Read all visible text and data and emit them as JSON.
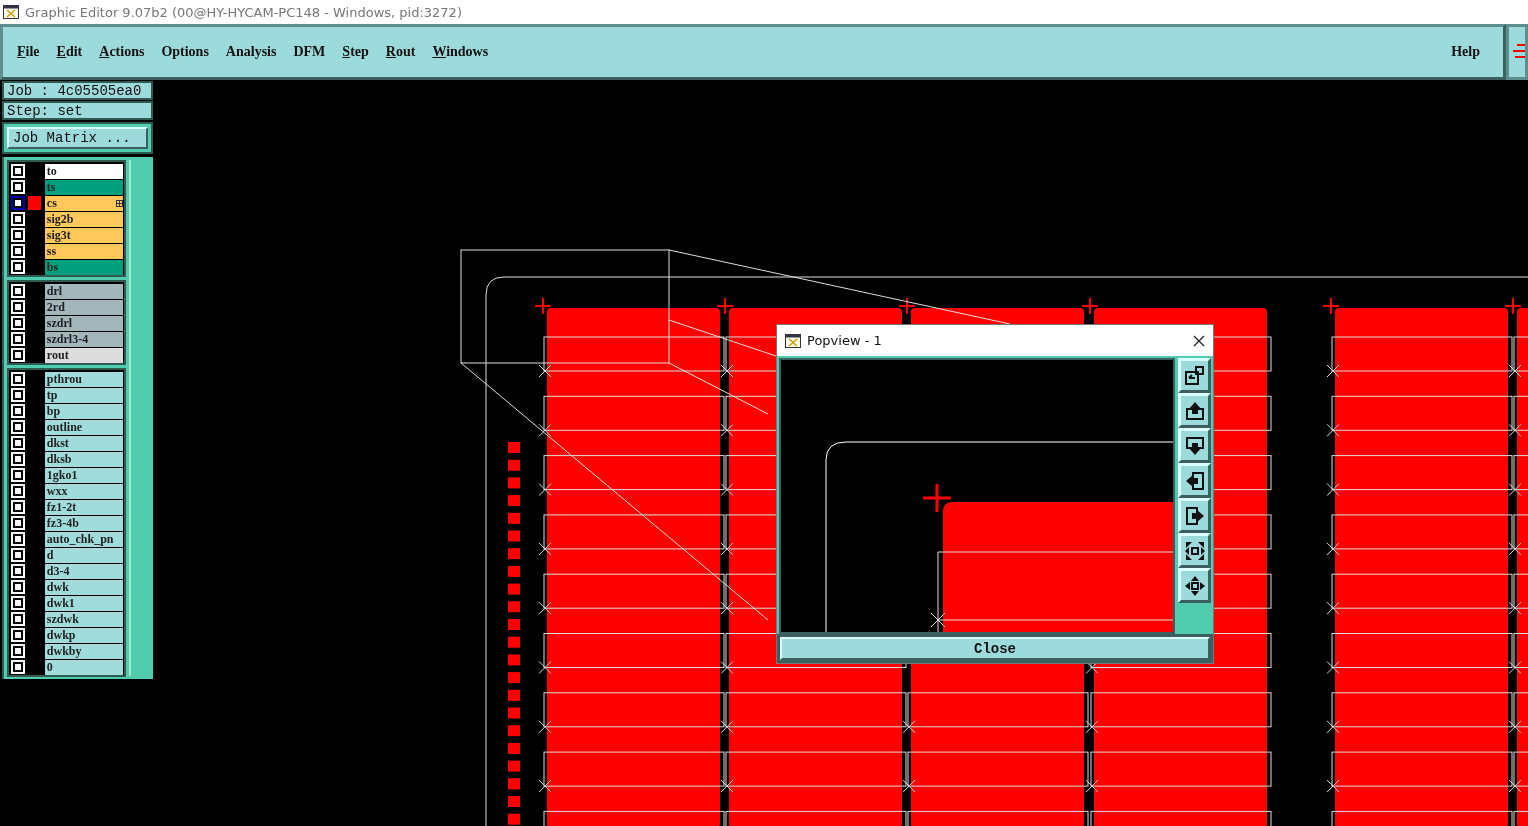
{
  "window": {
    "title": "Graphic Editor 9.07b2 (00@HY-HYCAM-PC148 - Windows, pid:3272)"
  },
  "menu": [
    {
      "label": "File",
      "mnemonic": true
    },
    {
      "label": "Edit",
      "mnemonic": true
    },
    {
      "label": "Actions",
      "mnemonic": true
    },
    {
      "label": "Options",
      "mnemonic": false
    },
    {
      "label": "Analysis",
      "mnemonic": false
    },
    {
      "label": "DFM",
      "mnemonic": false
    },
    {
      "label": "Step",
      "mnemonic": true
    },
    {
      "label": "Rout",
      "mnemonic": true
    },
    {
      "label": "Windows",
      "mnemonic": true
    }
  ],
  "help": {
    "label": "Help"
  },
  "job": "Job : 4c05505ea0",
  "step": "Step: set",
  "job_matrix_button": "Job Matrix ...",
  "layer_groups": [
    {
      "layers": [
        {
          "name": "to",
          "color": "#ffffff",
          "selected": false
        },
        {
          "name": "ts",
          "color": "#00a07c",
          "selected": false
        },
        {
          "name": "cs",
          "color": "#ffc85a",
          "selected": true
        },
        {
          "name": "sig2b",
          "color": "#ffc85a",
          "selected": false
        },
        {
          "name": "sig3t",
          "color": "#ffc85a",
          "selected": false
        },
        {
          "name": "ss",
          "color": "#ffc85a",
          "selected": false
        },
        {
          "name": "bs",
          "color": "#00a07c",
          "selected": false
        }
      ]
    },
    {
      "layers": [
        {
          "name": "drl",
          "color": "#a2b6bc",
          "selected": false
        },
        {
          "name": "2rd",
          "color": "#a2b6bc",
          "selected": false
        },
        {
          "name": "szdrl",
          "color": "#a2b6bc",
          "selected": false
        },
        {
          "name": "szdrl3-4",
          "color": "#a2b6bc",
          "selected": false
        },
        {
          "name": "rout",
          "color": "#dcdcdc",
          "selected": false
        }
      ]
    },
    {
      "layers": [
        {
          "name": "pthrou",
          "color": "#a0dcdc",
          "selected": false
        },
        {
          "name": "tp",
          "color": "#a0dcdc",
          "selected": false
        },
        {
          "name": "bp",
          "color": "#a0dcdc",
          "selected": false
        },
        {
          "name": "outline",
          "color": "#a0dcdc",
          "selected": false
        },
        {
          "name": "dkst",
          "color": "#a0dcdc",
          "selected": false
        },
        {
          "name": "dksb",
          "color": "#a0dcdc",
          "selected": false
        },
        {
          "name": "1gko1",
          "color": "#a0dcdc",
          "selected": false
        },
        {
          "name": "wxx",
          "color": "#a0dcdc",
          "selected": false
        },
        {
          "name": "fz1-2t",
          "color": "#a0dcdc",
          "selected": false
        },
        {
          "name": "fz3-4b",
          "color": "#a0dcdc",
          "selected": false
        },
        {
          "name": "auto_chk_pn",
          "color": "#a0dcdc",
          "selected": false
        },
        {
          "name": "d",
          "color": "#a0dcdc",
          "selected": false
        },
        {
          "name": "d3-4",
          "color": "#a0dcdc",
          "selected": false
        },
        {
          "name": "dwk",
          "color": "#a0dcdc",
          "selected": false
        },
        {
          "name": "dwk1",
          "color": "#a0dcdc",
          "selected": false
        },
        {
          "name": "szdwk",
          "color": "#a0dcdc",
          "selected": false
        },
        {
          "name": "dwkp",
          "color": "#a0dcdc",
          "selected": false
        },
        {
          "name": "dwkby",
          "color": "#a0dcdc",
          "selected": false
        },
        {
          "name": "0",
          "color": "#a0dcdc",
          "selected": false
        }
      ]
    }
  ],
  "popview": {
    "title": "Popview - 1",
    "close_button": "Close"
  }
}
